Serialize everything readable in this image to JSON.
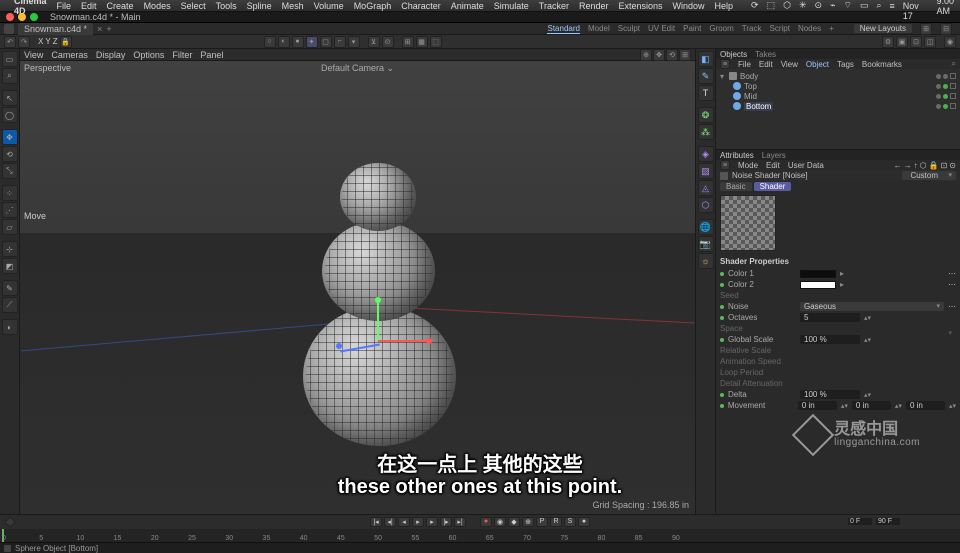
{
  "menubar": {
    "app": "Cinema 4D",
    "items": [
      "File",
      "Edit",
      "Create",
      "Modes",
      "Select",
      "Tools",
      "Spline",
      "Mesh",
      "Volume",
      "MoGraph",
      "Character",
      "Animate",
      "Simulate",
      "Tracker",
      "Render",
      "Extensions",
      "Window",
      "Help"
    ],
    "date": "Wed Nov 17",
    "time": "9:00 AM"
  },
  "window": {
    "title": "Snowman.c4d * - Main"
  },
  "doctab": {
    "name": "Snowman.c4d *"
  },
  "coordbar": {
    "x": "X",
    "y": "Y",
    "z": "Z"
  },
  "modetabs": {
    "items": [
      "Standard",
      "Model",
      "Sculpt",
      "UV Edit",
      "Paint",
      "Groom",
      "Track",
      "Script",
      "Nodes"
    ],
    "selected": 0,
    "newlayouts": "New Layouts"
  },
  "viewport": {
    "menus": [
      "View",
      "Cameras",
      "Display",
      "Options",
      "Filter",
      "Panel"
    ],
    "label": "Perspective",
    "camera": "Default Camera",
    "move": "Move",
    "hud": "Grid Spacing : 196.85 in"
  },
  "objmgr": {
    "tabs": [
      "Objects",
      "Takes"
    ],
    "tabsel": 0,
    "menus": [
      "File",
      "Edit",
      "View",
      "Object",
      "Tags",
      "Bookmarks"
    ],
    "menusel": 3,
    "items": [
      {
        "name": "Body",
        "indent": 0,
        "type": "null",
        "open": true
      },
      {
        "name": "Top",
        "indent": 1,
        "type": "sphere"
      },
      {
        "name": "Mid",
        "indent": 1,
        "type": "sphere"
      },
      {
        "name": "Bottom",
        "indent": 1,
        "type": "sphere",
        "selected": true
      }
    ]
  },
  "attr": {
    "tabs": [
      "Attributes",
      "Layers"
    ],
    "tabsel": 0,
    "menus": [
      "Mode",
      "Edit",
      "User Data"
    ],
    "shader": "Noise Shader [Noise]",
    "custom": "Custom",
    "subtabs": [
      "Basic",
      "Shader"
    ],
    "subsel": 1,
    "title": "Shader Properties",
    "props": {
      "color1": {
        "label": "Color 1",
        "value": "#0d0d0d"
      },
      "color2": {
        "label": "Color 2",
        "value": "#ffffff"
      },
      "seed": {
        "label": "Seed"
      },
      "noise": {
        "label": "Noise",
        "value": "Gaseous"
      },
      "octaves": {
        "label": "Octaves",
        "value": "5"
      },
      "space": {
        "label": "Space"
      },
      "globalscale": {
        "label": "Global Scale",
        "value": "100 %"
      },
      "relscale": {
        "label": "Relative Scale"
      },
      "animspeed": {
        "label": "Animation Speed"
      },
      "loopperiod": {
        "label": "Loop Period"
      },
      "detailatten": {
        "label": "Detail Attenuation"
      },
      "delta": {
        "label": "Delta",
        "value": "100 %"
      },
      "movement": {
        "label": "Movement",
        "vals": [
          "0 in",
          "0 in",
          "0 in"
        ]
      }
    }
  },
  "timeline": {
    "start": "0 F",
    "end": "90 F",
    "ticks": [
      "0",
      "5",
      "10",
      "15",
      "20",
      "25",
      "30",
      "35",
      "40",
      "45",
      "50",
      "55",
      "60",
      "65",
      "70",
      "75",
      "80",
      "85",
      "90"
    ]
  },
  "status": {
    "text": "Sphere Object [Bottom]"
  },
  "subtitles": {
    "cn": "在这一点上 其他的这些",
    "en": "these other ones at this point."
  },
  "watermark": {
    "cn": "灵感中国",
    "en": "lingganchina.com"
  }
}
